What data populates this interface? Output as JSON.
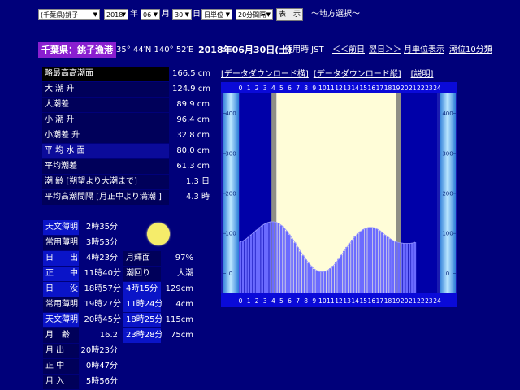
{
  "form": {
    "prefecture": "(千葉県)銚子",
    "year": "2018",
    "year_unit": "年",
    "month": "06",
    "month_unit": "月",
    "day": "30",
    "day_unit": "日",
    "span": "日単位",
    "interval": "20分間隔",
    "show_button": "表　示",
    "region_link": "～地方選択～"
  },
  "header": {
    "location": "千葉県：銚子漁港",
    "coords": "35° 44′N 140° 52′E",
    "date": "2018年06月30日(土)",
    "timezone": "使用時 JST",
    "prev": "＜＜前日",
    "next": "翌日＞＞",
    "month_view": "月単位表示",
    "ten_min": "潮位10分類"
  },
  "stats": [
    {
      "label": "略最高高潮面",
      "value": "166.5 cm"
    },
    {
      "label": "大 潮 升",
      "value": "124.9 cm"
    },
    {
      "label": "大潮差",
      "value": "89.9 cm"
    },
    {
      "label": "小 潮 升",
      "value": "96.4 cm"
    },
    {
      "label": "小潮差 升",
      "value": "32.8 cm"
    },
    {
      "label": "平 均 水 面",
      "value": "80.0 cm"
    },
    {
      "label": "平均潮差",
      "value": "61.3 cm"
    },
    {
      "label": "潮 齢 [朔望より大潮まで]",
      "value": "1.3 日"
    },
    {
      "label": "平均高潮間隔 [月正中より満潮 ]",
      "value": "4.3 時"
    }
  ],
  "sun_moon": [
    {
      "label": "天文薄明",
      "value": "2時35分"
    },
    {
      "label": "常用薄明",
      "value": "3時53分"
    },
    {
      "label": "日　　出",
      "value": "4時23分"
    },
    {
      "label": "正　　中",
      "value": "11時40分"
    },
    {
      "label": "日　　没",
      "value": "18時57分"
    },
    {
      "label": "常用薄明",
      "value": "19時27分"
    },
    {
      "label": "天文薄明",
      "value": "20時45分"
    },
    {
      "label": "月　齢",
      "value": "16.2"
    },
    {
      "label": "月 出",
      "value": "20時23分"
    },
    {
      "label": "正 中",
      "value": "0時47分"
    },
    {
      "label": "月 入",
      "value": "5時56分"
    }
  ],
  "moon": {
    "illum_label": "月輝面",
    "illum_value": "97%",
    "tide_label": "潮回り",
    "tide_value": "大潮",
    "icon": "full-moon-icon",
    "tides": [
      {
        "time": "4時15分",
        "level": "129cm"
      },
      {
        "time": "11時24分",
        "level": "4cm"
      },
      {
        "time": "18時25分",
        "level": "115cm"
      },
      {
        "time": "23時28分",
        "level": "75cm"
      }
    ]
  },
  "chart_links": {
    "download_h": "[データダウンロード横]",
    "download_v": "[データダウンロード縦]",
    "explain": "[説明]"
  },
  "chart_data": {
    "type": "area",
    "x_ticks": [
      "0",
      "1",
      "2",
      "3",
      "4",
      "5",
      "6",
      "7",
      "8",
      "9",
      "10",
      "11",
      "12",
      "13",
      "14",
      "15",
      "16",
      "17",
      "18",
      "19",
      "20",
      "21",
      "22",
      "23",
      "24"
    ],
    "y_ticks": [
      "400",
      "300",
      "200",
      "100",
      "0"
    ],
    "ylim": [
      -50,
      450
    ],
    "xlim": [
      0,
      24
    ],
    "daylight": [
      4.38,
      18.95
    ],
    "x": [
      0,
      0.33,
      0.67,
      1,
      1.33,
      1.67,
      2,
      2.33,
      2.67,
      3,
      3.33,
      3.67,
      4,
      4.33,
      4.67,
      5,
      5.33,
      5.67,
      6,
      6.33,
      6.67,
      7,
      7.33,
      7.67,
      8,
      8.33,
      8.67,
      9,
      9.33,
      9.67,
      10,
      10.33,
      10.67,
      11,
      11.33,
      11.67,
      12,
      12.33,
      12.67,
      13,
      13.33,
      13.67,
      14,
      14.33,
      14.67,
      15,
      15.33,
      15.67,
      16,
      16.33,
      16.67,
      17,
      17.33,
      17.67,
      18,
      18.33,
      18.67,
      19,
      19.33,
      19.67,
      20,
      20.33,
      20.67,
      21,
      21.33,
      21.67,
      22,
      22.33,
      22.67,
      23,
      23.33,
      23.67,
      24
    ],
    "y": [
      79,
      82,
      86,
      91,
      97,
      103,
      109,
      115,
      120,
      124,
      127,
      129,
      129,
      128,
      125,
      120,
      114,
      106,
      97,
      87,
      77,
      66,
      55,
      45,
      35,
      26,
      18,
      11,
      7,
      4,
      4,
      5,
      8,
      13,
      19,
      27,
      36,
      46,
      56,
      66,
      75,
      84,
      92,
      99,
      105,
      110,
      113,
      115,
      115,
      114,
      111,
      107,
      102,
      96,
      91,
      86,
      82,
      79,
      77,
      76,
      75,
      75,
      75,
      76,
      78
    ]
  }
}
